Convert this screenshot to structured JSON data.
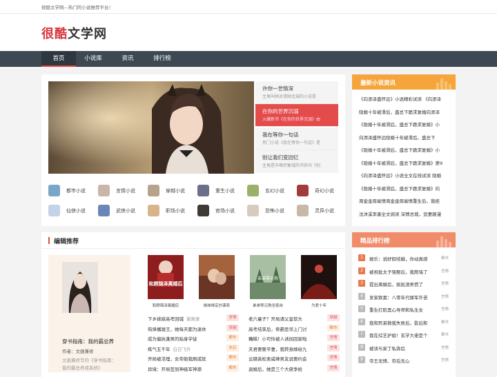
{
  "topbar": {
    "text": "很酷文学网—热门的小说推荐平台！"
  },
  "logo": {
    "part1": "很酷",
    "part2": "文学网"
  },
  "nav": {
    "items": [
      "首页",
      "小说库",
      "资讯",
      "排行榜"
    ]
  },
  "slides": [
    {
      "title": "许你一世情深",
      "desc": "主角叫林冰清顾北城的小说是"
    },
    {
      "title": "在你的世界沉溺",
      "desc": "火爆新书《在你的世界沉溺》由"
    },
    {
      "title": "我在等你一句话",
      "desc": "热门小说《我在等你一句话》是"
    },
    {
      "title": "别让我们变回忆",
      "desc": "主角是辛蒂厉衡城的书名叫《别"
    }
  ],
  "categories": [
    "都市小说",
    "言情小说",
    "穿越小说",
    "重生小说",
    "玄幻小说",
    "奇幻小说",
    "仙侠小说",
    "武侠小说",
    "职场小说",
    "官场小说",
    "恐怖小说",
    "灵异小说"
  ],
  "editor": {
    "heading": "编辑推荐",
    "feature": {
      "title": "穿书指南：我的霸总养",
      "author": "作者：文画兼修",
      "desc": "文画兼修写的《穿书指南：我的霸总养成系统》"
    },
    "books": [
      {
        "title": "和顾锦泽离婚后",
        "cover_text": "和顾锦泽离婚后"
      },
      {
        "title": "姊妹绑定抄袭系",
        "cover_text": ""
      },
      {
        "title": "弟弟零元购全家自",
        "cover_text": "弟弟零元购"
      },
      {
        "title": "为爱十年",
        "cover_text": ""
      }
    ],
    "list_left": [
      {
        "text": "下乡妹妹高考回城",
        "author": "谢离宴",
        "tag": "言情"
      },
      {
        "text": "徇烽播跋王，她每天都为退休",
        "tag": "穿越"
      },
      {
        "text": "成为偏执蓬男的贴身学徒",
        "tag": "都市"
      },
      {
        "text": "练气五千年",
        "author": "白日飞升",
        "tag": "玄幻"
      },
      {
        "text": "开局被活埋，女帝助我刷成就",
        "tag": "都市"
      },
      {
        "text": "异境：开局签到神级军神源",
        "tag": "都市"
      }
    ],
    "list_right": [
      {
        "text": "老六童子？开局请父皇软头",
        "tag": "穿越"
      },
      {
        "text": "高考结束后，奇葩恶邻上门讨",
        "tag": "都市"
      },
      {
        "text": "糟糕！小可怜被人诱拐回家啦",
        "tag": "言情"
      },
      {
        "text": "夫君要娶平妻，我转身嫁给九",
        "tag": "言情"
      },
      {
        "text": "云璐袁松柔咸峰男友说要约会",
        "tag": "言情"
      },
      {
        "text": "退婚后，她是三个大佬争抢",
        "tag": "言情"
      }
    ]
  },
  "news": {
    "heading": "最新小说资讯",
    "items": [
      "《向添泽盛怀远》小说精彩试读 《向添泽",
      "隐婚十年被滑后，盛总下跪求复婚向添泽",
      "《隐婚十年被滑后，盛总下跪求复婚》小",
      "向添泽盛怀远隐婚十年被滑后，盛总下",
      "《隐婚十年被滑后，盛总下跪求复婚》小",
      "《隐婚十年被滑后，盛总下跪求复婚》第9",
      "《向添泽盛怀远》小说全文在线试读 隐婚",
      "《隐婚十年被滑后，盛总下跪求复婚》向",
      "周金金周瑜情周金金周瑜情重生后，我拒",
      "沈沐溪李墨全文阅读 深情总裁，追妻路漫"
    ]
  },
  "rank": {
    "heading": "精品排行榜",
    "items": [
      {
        "n": "1",
        "t": "娱乐：说好假结婚，你动真感",
        "c": "都市"
      },
      {
        "n": "2",
        "t": "被祝批太子强娶后，我爬墙了",
        "c": "言情"
      },
      {
        "n": "3",
        "t": "提出离婚后，疯批渣男慌了",
        "c": "言情"
      },
      {
        "n": "4",
        "t": "发家致富：八零年代嫁军外苦",
        "c": "言情"
      },
      {
        "n": "5",
        "t": "重生打脸黑心导师和私生女",
        "c": "言情"
      },
      {
        "n": "6",
        "t": "我和死弟救我失败后，影后和",
        "c": "都市"
      },
      {
        "n": "7",
        "t": "我在综艺护娘！玄学大佬是个",
        "c": "都市"
      },
      {
        "n": "8",
        "t": "被读与家丁私奔后",
        "c": "言情"
      },
      {
        "n": "9",
        "t": "帝王无情、帝后无心",
        "c": "言情"
      }
    ]
  },
  "colors": {
    "accent": "#e24a3b",
    "nav": "#3d4852",
    "news_head": "#f5a53b",
    "rank_head": "#f08c6a"
  }
}
